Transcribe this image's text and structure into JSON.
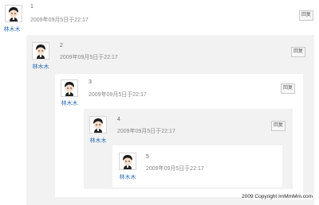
{
  "comments": [
    {
      "number": "1",
      "author": "林木木",
      "date": "2009年09月5日于22:17",
      "reply_label": "回复",
      "avatar_icon": "cartoon-boy-avatar-icon"
    },
    {
      "number": "2",
      "author": "林木木",
      "date": "2009年09月5日于22:17",
      "reply_label": "回复",
      "avatar_icon": "cartoon-boy-avatar-icon"
    },
    {
      "number": "3",
      "author": "林木木",
      "date": "2009年09月5日于22:17",
      "reply_label": "回复",
      "avatar_icon": "cartoon-boy-avatar-icon"
    },
    {
      "number": "4",
      "author": "林木木",
      "date": "2009年09月5日于22:17",
      "reply_label": "回复",
      "avatar_icon": "cartoon-boy-avatar-icon"
    },
    {
      "number": "5",
      "author": "林木木",
      "date": "2009年09月5日于22:17",
      "avatar_icon": "cartoon-boy-avatar-icon"
    }
  ],
  "footer": {
    "copyright": "2009 Copyright ImMmMm.com"
  },
  "colors": {
    "nested_bg": "#f2f2f2",
    "author_link": "#2a6fb5"
  }
}
